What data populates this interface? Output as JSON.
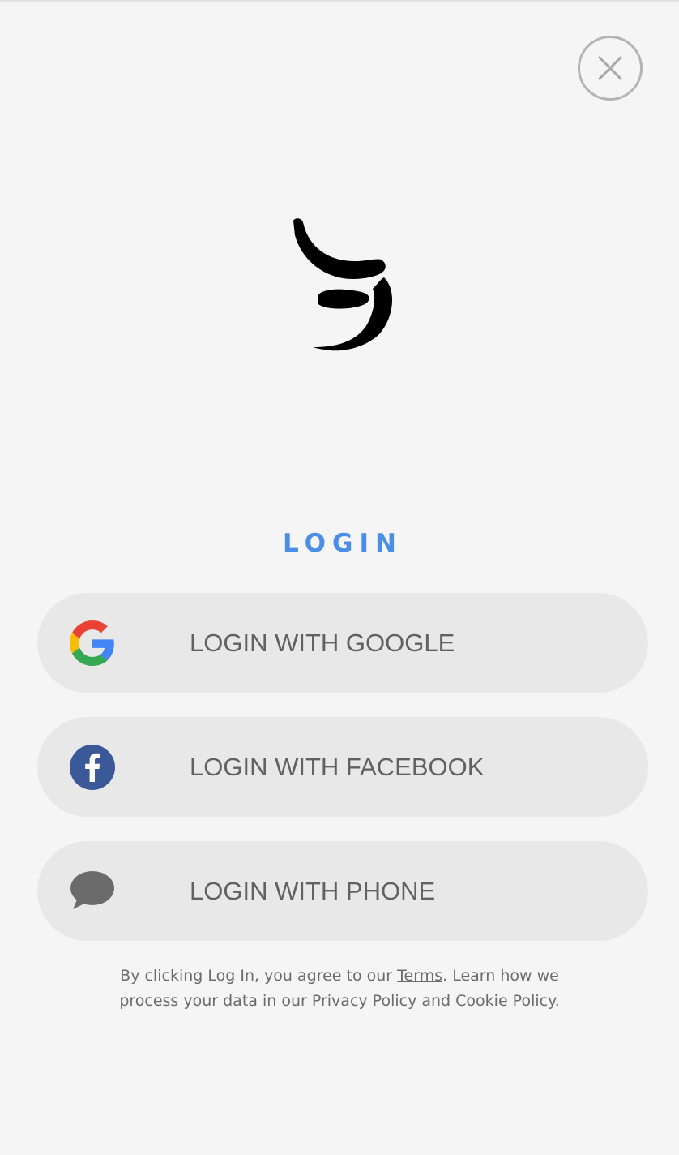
{
  "close": {
    "icon": "close-icon"
  },
  "logo": {
    "icon": "brand-logo"
  },
  "title": "LOGIN",
  "buttons": {
    "google": {
      "label": "LOGIN WITH GOOGLE",
      "icon": "google-icon"
    },
    "facebook": {
      "label": "LOGIN WITH FACEBOOK",
      "icon": "facebook-icon"
    },
    "phone": {
      "label": "LOGIN WITH PHONE",
      "icon": "chat-bubble-icon"
    }
  },
  "disclaimer": {
    "part1": "By clicking Log In, you agree to our ",
    "terms": "Terms",
    "part2": ". Learn how we",
    "part3": "process your data in our ",
    "privacy": "Privacy Policy",
    "part4": " and ",
    "cookie": "Cookie Policy",
    "part5": "."
  },
  "colors": {
    "background": "#f5f5f5",
    "accent": "#4a8ee8",
    "button_bg": "#e8e8e8",
    "button_text": "#616161",
    "facebook": "#3b5998"
  }
}
